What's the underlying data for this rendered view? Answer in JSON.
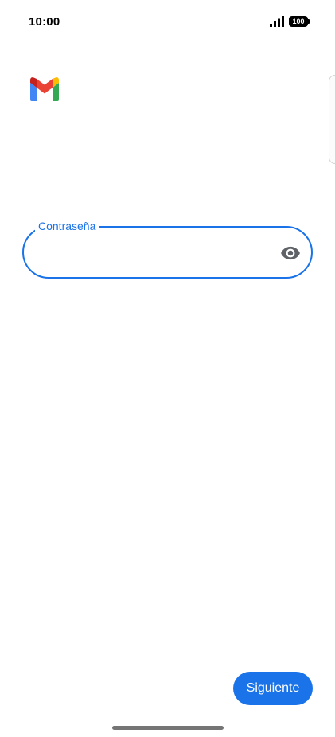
{
  "status_bar": {
    "time": "10:00",
    "battery": "100",
    "icons": [
      "signal-icon",
      "battery-icon"
    ]
  },
  "app": {
    "logo": "gmail-logo-icon"
  },
  "password_field": {
    "label": "Contraseña",
    "value": "",
    "placeholder": "",
    "toggle_icon": "eye-icon"
  },
  "actions": {
    "next_label": "Siguiente"
  },
  "colors": {
    "accent": "#1a73e8",
    "background": "#ffffff",
    "icon_gray": "#5f6368"
  }
}
